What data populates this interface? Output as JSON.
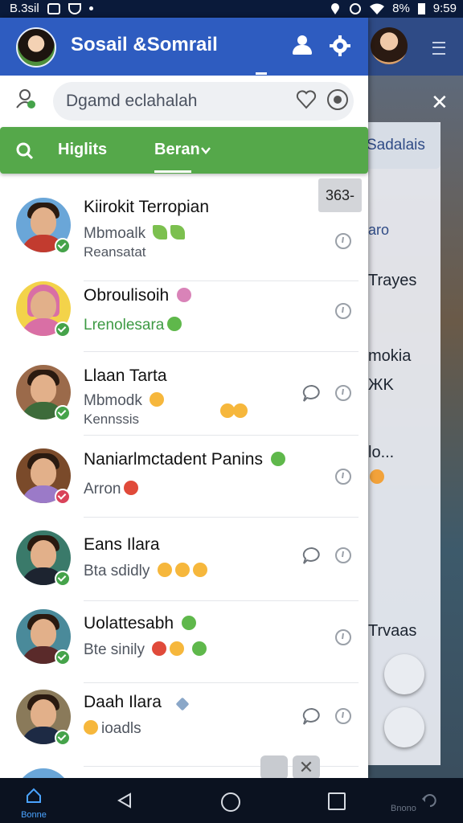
{
  "status_bar": {
    "left_text": "B.3sil",
    "right_text": "8%",
    "time": "9:59"
  },
  "app_bar": {
    "title": "Sosail &Somrail",
    "icons": [
      "person-icon",
      "gear-icon"
    ],
    "accent": "#2e5cc0"
  },
  "search": {
    "placeholder": "Dgamd eclahalah",
    "icons": [
      "profile-icon",
      "heart-icon",
      "globe-icon"
    ]
  },
  "filter_bar": {
    "tab1": "Higlits",
    "tab2": "Beran",
    "accent": "#55a84a"
  },
  "counter_badge": "363-",
  "contacts": [
    {
      "name": "Kiirokit Terropian",
      "line1": "Mbmoalk",
      "line2": "Reansatat",
      "badge": "green"
    },
    {
      "name": "Obroulisoih",
      "line1": "Lrenolesara",
      "line2": "",
      "badge": "green"
    },
    {
      "name": "Llaan Tarta",
      "line1": "Mbmodk",
      "line2": "Kennssis",
      "badge": "green"
    },
    {
      "name": "Naniarlmctadent Panins",
      "line1": "Arron",
      "line2": "",
      "badge": "red"
    },
    {
      "name": "Eans Ilara",
      "line1": "Bta sdidly",
      "line2": "",
      "badge": "green"
    },
    {
      "name": "Uolattesabh",
      "line1": "Bte sinily",
      "line2": "",
      "badge": "green"
    },
    {
      "name": "Daah Ilara",
      "line1": "ioadls",
      "line2": "",
      "badge": "green"
    }
  ],
  "background_chat": {
    "chip": "Sadalais",
    "lines": [
      "aro",
      "Trayes",
      "mokia",
      "ЖK",
      "lo...",
      "Trvaas"
    ]
  },
  "nav": {
    "home_label": "Bonne",
    "right_label": "Bnono"
  }
}
